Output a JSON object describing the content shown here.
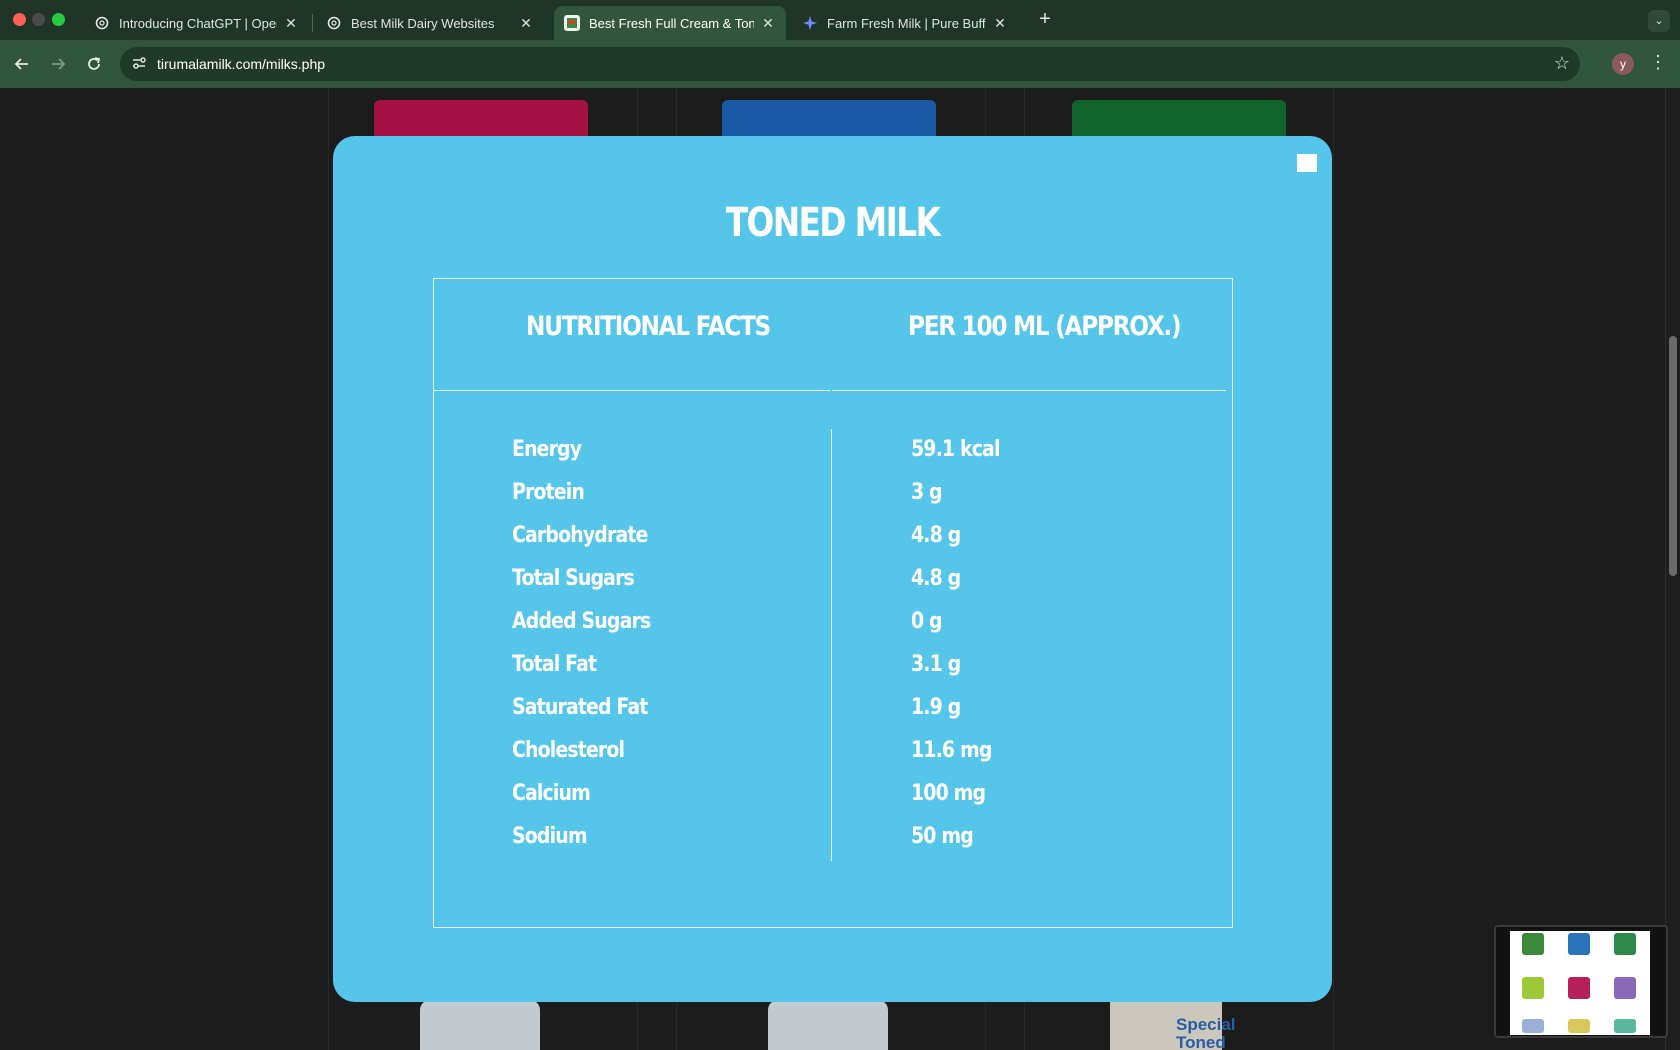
{
  "browser": {
    "tabs": [
      {
        "title": "Introducing ChatGPT | OpenAI",
        "close": "✕"
      },
      {
        "title": "Best Milk Dairy Websites",
        "close": "✕"
      },
      {
        "title": "Best Fresh Full Cream & Toned",
        "close": "✕"
      },
      {
        "title": "Farm Fresh Milk | Pure Buffalo",
        "close": "✕"
      }
    ],
    "new_tab": "+",
    "tab_menu": "⌄",
    "url": "tirumalamilk.com/milks.php",
    "profile_initial": "y"
  },
  "modal": {
    "title": "TONED MILK",
    "close_label": "",
    "header": {
      "left": "NUTRITIONAL FACTS",
      "right": "PER 100 ML (APPROX.)"
    },
    "rows": [
      {
        "name": "Energy",
        "value": "59.1 kcal"
      },
      {
        "name": "Protein",
        "value": "3 g"
      },
      {
        "name": "Carbohydrate",
        "value": "4.8 g"
      },
      {
        "name": "Total Sugars",
        "value": "4.8 g"
      },
      {
        "name": "Added Sugars",
        "value": "0 g"
      },
      {
        "name": "Total Fat",
        "value": "3.1 g"
      },
      {
        "name": "Saturated Fat",
        "value": "1.9 g"
      },
      {
        "name": "Cholesterol",
        "value": "11.6 mg"
      },
      {
        "name": "Calcium",
        "value": "100 mg"
      },
      {
        "name": "Sodium",
        "value": "50 mg"
      }
    ]
  },
  "background": {
    "special_label": "Special Toned"
  },
  "colors": {
    "modal_bg": "#55c6ea",
    "chrome_tab": "#31563d",
    "chrome_bar": "#1f3528"
  }
}
